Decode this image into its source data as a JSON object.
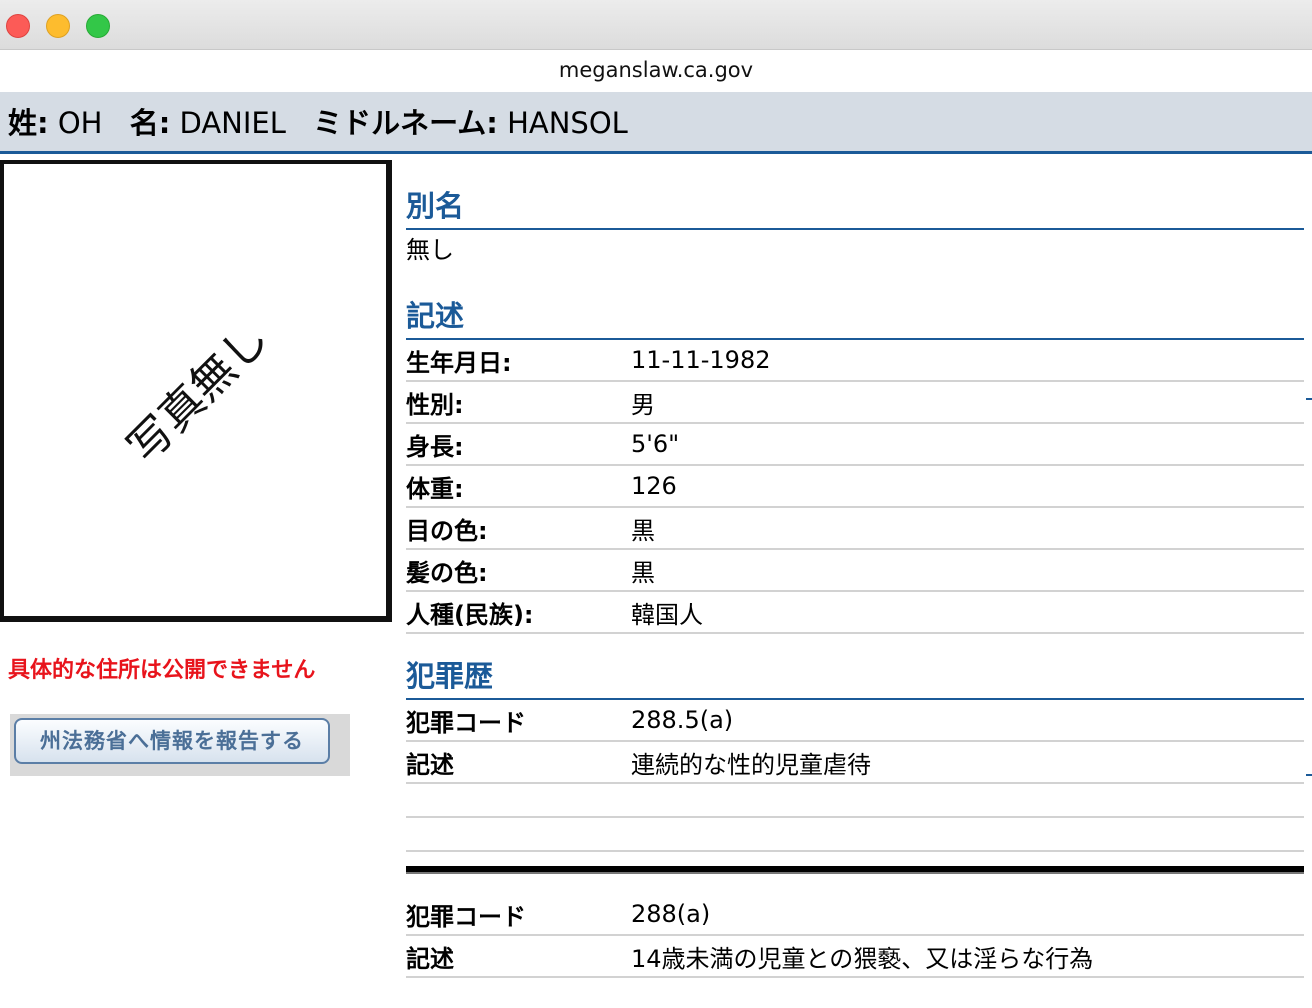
{
  "window": {
    "url": "meganslaw.ca.gov"
  },
  "header": {
    "last_label": "姓:",
    "last_value": "OH",
    "first_label": "名:",
    "first_value": "DANIEL",
    "middle_label": "ミドルネーム:",
    "middle_value": "HANSOL"
  },
  "photo": {
    "placeholder": "写真無し"
  },
  "address_notice": "具体的な住所は公開できません",
  "report_button": "州法務省へ情報を報告する",
  "aliases": {
    "title": "別名",
    "value": "無し"
  },
  "description": {
    "title": "記述",
    "rows": [
      {
        "label": "生年月日:",
        "value": "11-11-1982"
      },
      {
        "label": "性別:",
        "value": "男"
      },
      {
        "label": "身長:",
        "value": "5'6\""
      },
      {
        "label": "体重:",
        "value": "126"
      },
      {
        "label": "目の色:",
        "value": "黒"
      },
      {
        "label": "髪の色:",
        "value": "黒"
      },
      {
        "label": "人種(民族):",
        "value": "韓国人"
      }
    ]
  },
  "offenses": {
    "title": "犯罪歴",
    "code_label": "犯罪コード",
    "desc_label": "記述",
    "items": [
      {
        "code": "288.5(a)",
        "description": "連続的な性的児童虐待"
      },
      {
        "code": "288(a)",
        "description": "14歳未満の児童との猥褻、又は淫らな行為"
      }
    ]
  },
  "colors": {
    "accent": "#1b5a98",
    "header_bg": "#d5dce4",
    "notice_red": "#e8141c"
  }
}
